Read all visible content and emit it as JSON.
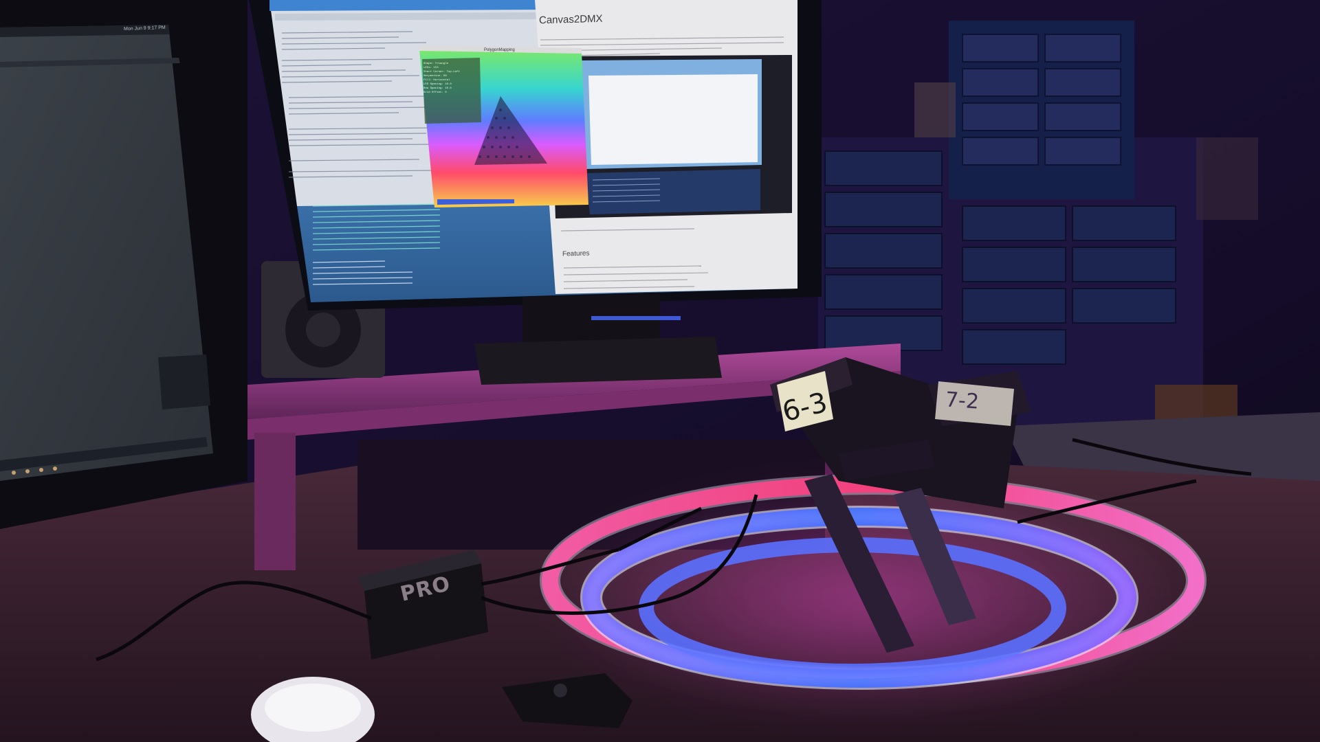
{
  "scene": {
    "colors": {
      "room": "#140c26",
      "desk": "#3a2030",
      "shelf": "#8b3f7a",
      "monitor_bezel": "#0c0c12",
      "led_blue": "#4f6cff",
      "led_pink": "#ff4fa3",
      "screen_blue": "#4a8fd6",
      "browser_white": "#e9e9ec"
    }
  },
  "screen": {
    "page_title": "Canvas2DMX",
    "features_heading": "Features",
    "clock": "Mon Jun 9 9:17 PM",
    "window_title": "PolygonMapping",
    "overlay_lines": [
      "Shape: Triangle",
      "LEDs: 153",
      "Start Corner: Top-Left",
      "Serpentine: ON",
      "Fill: Horizontal",
      "LED Spacing: 10.0",
      "Row Spacing: 10.0",
      "Grid Offset: 0"
    ]
  },
  "labels": {
    "tag_a": "6-3",
    "tag_b": "7-2",
    "device": "PRO"
  }
}
